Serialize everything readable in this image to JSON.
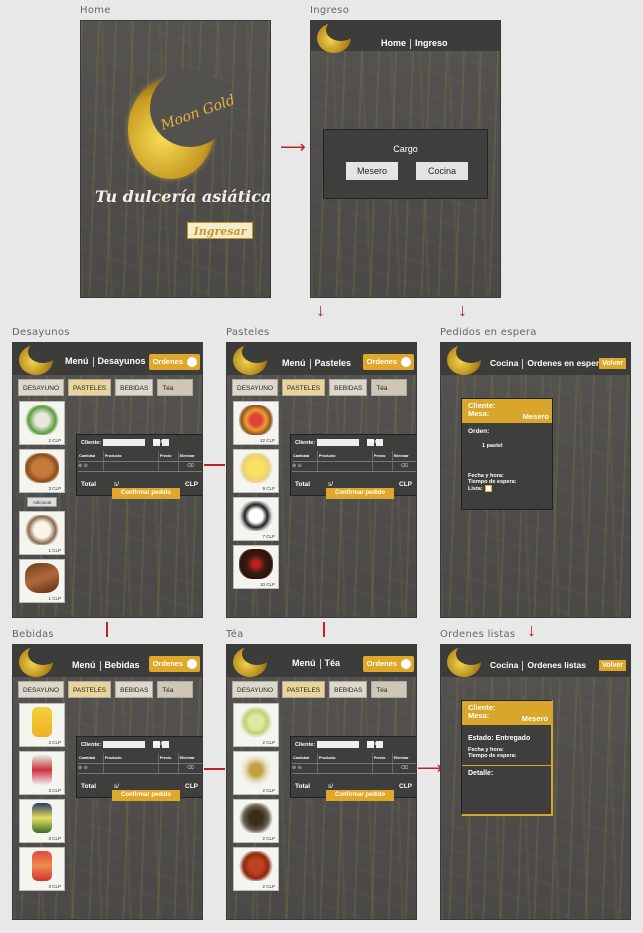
{
  "captions": {
    "home": "Home",
    "ingreso": "Ingreso",
    "desayunos": "Desayunos",
    "pasteles": "Pasteles",
    "pedidos": "Pedidos en espera",
    "bebidas": "Bebidas",
    "tea": "Téa",
    "listas": "Ordenes listas"
  },
  "home": {
    "tagline": "Tu dulcería asiática",
    "logo_text": "Moon Gold",
    "enter_button": "Ingresar"
  },
  "ingreso": {
    "nav_home": "Home",
    "nav_ingreso": "Ingreso",
    "cargo_title": "Cargo",
    "mesero_button": "Mesero",
    "cocina_button": "Cocina"
  },
  "menu": {
    "menu_label": "Menú",
    "ordenes_button": "Ordenes",
    "tabs": [
      "DESAYUNO",
      "PASTELES",
      "BEBIDAS",
      "Téa"
    ],
    "cliente_label": "Cliente:",
    "mesa_label": "Mesa:",
    "col_cantidad": "Cantidad",
    "col_producto": "Producto",
    "col_precio": "Precio",
    "col_eliminar": "Eliminar",
    "total_label": "Total",
    "currency_prefix": "s/",
    "currency": "CLP",
    "confirm_button": "Confirmar pedido",
    "adicional_button": "Adicional"
  },
  "desayunos": {
    "section": "Desayunos",
    "prices": [
      "2 CLP",
      "3 CLP",
      "1 CLP",
      "1 CLP"
    ]
  },
  "pasteles": {
    "section": "Pasteles",
    "prices": [
      "12 CLP",
      "9 CLP",
      "7 CLP",
      "10 CLP"
    ]
  },
  "bebidas": {
    "section": "Bebidas",
    "prices": [
      "3 CLP",
      "3 CLP",
      "3 CLP",
      "3 CLP"
    ]
  },
  "tea": {
    "section": "Téa",
    "prices": [
      "2 CLP",
      "2 CLP",
      "2 CLP",
      "2 CLP"
    ]
  },
  "cocina": {
    "nav_cocina": "Cocina",
    "nav_espera": "Ordenes en espera",
    "nav_listas": "Ordenes listas",
    "volver_button": "Volver",
    "cliente": "Cliente:",
    "mesa": "Mesa:",
    "mesero": "Mesero",
    "orden_label": "Orden:",
    "orden_item": "1 pastel",
    "fecha": "Fecha y hora:",
    "tiempo": "Tiempo de espera:",
    "lista": "Lista:",
    "estado": "Estado: Entregado",
    "detalle": "Detalle:"
  },
  "colors": {
    "accent": "#e0a82a",
    "arrow": "#c42020",
    "screen_bg": "#4a4a48"
  }
}
